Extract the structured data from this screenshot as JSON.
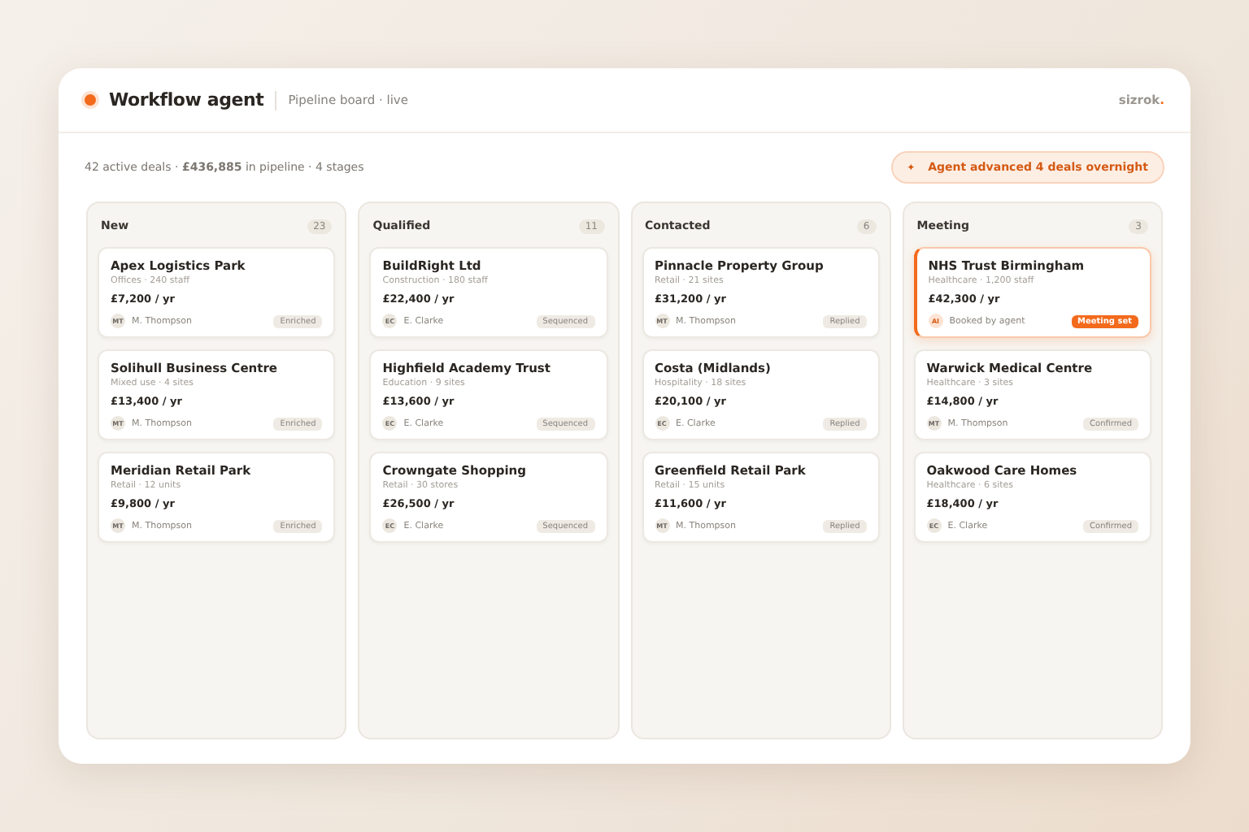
{
  "header": {
    "title": "Workflow agent",
    "subtitle": "Pipeline board · live",
    "brand": "sizrok",
    "brand_mark": "."
  },
  "summary": {
    "text": "42 active deals · **£436,885** in pipeline · 4 stages",
    "alert_icon": "✦",
    "alert": "Agent advanced 4 deals overnight"
  },
  "columns": [
    {
      "name": "New",
      "count": "23",
      "cards": [
        {
          "title": "Apex Logistics Park",
          "meta": "Offices · 240 staff",
          "value": "£7,200 / yr",
          "initials": "MT",
          "owner": "M. Thompson",
          "tag": "Enriched",
          "highlighted": false
        },
        {
          "title": "Solihull Business Centre",
          "meta": "Mixed use · 4 sites",
          "value": "£13,400 / yr",
          "initials": "MT",
          "owner": "M. Thompson",
          "tag": "Enriched",
          "highlighted": false
        },
        {
          "title": "Meridian Retail Park",
          "meta": "Retail · 12 units",
          "value": "£9,800 / yr",
          "initials": "MT",
          "owner": "M. Thompson",
          "tag": "Enriched",
          "highlighted": false
        }
      ]
    },
    {
      "name": "Qualified",
      "count": "11",
      "cards": [
        {
          "title": "BuildRight Ltd",
          "meta": "Construction · 180 staff",
          "value": "£22,400 / yr",
          "initials": "EC",
          "owner": "E. Clarke",
          "tag": "Sequenced",
          "highlighted": false
        },
        {
          "title": "Highfield Academy Trust",
          "meta": "Education · 9 sites",
          "value": "£13,600 / yr",
          "initials": "EC",
          "owner": "E. Clarke",
          "tag": "Sequenced",
          "highlighted": false
        },
        {
          "title": "Crowngate Shopping",
          "meta": "Retail · 30 stores",
          "value": "£26,500 / yr",
          "initials": "EC",
          "owner": "E. Clarke",
          "tag": "Sequenced",
          "highlighted": false
        }
      ]
    },
    {
      "name": "Contacted",
      "count": "6",
      "cards": [
        {
          "title": "Pinnacle Property Group",
          "meta": "Retail · 21 sites",
          "value": "£31,200 / yr",
          "initials": "MT",
          "owner": "M. Thompson",
          "tag": "Replied",
          "highlighted": false
        },
        {
          "title": "Costa (Midlands)",
          "meta": "Hospitality · 18 sites",
          "value": "£20,100 / yr",
          "initials": "EC",
          "owner": "E. Clarke",
          "tag": "Replied",
          "highlighted": false
        },
        {
          "title": "Greenfield Retail Park",
          "meta": "Retail · 15 units",
          "value": "£11,600 / yr",
          "initials": "MT",
          "owner": "M. Thompson",
          "tag": "Replied",
          "highlighted": false
        }
      ]
    },
    {
      "name": "Meeting",
      "count": "3",
      "cards": [
        {
          "title": "NHS Trust Birmingham",
          "meta": "Healthcare · 1,200 staff",
          "value": "£42,300 / yr",
          "initials": "AI",
          "owner": "Booked by agent",
          "tag": "Meeting set",
          "highlighted": true
        },
        {
          "title": "Warwick Medical Centre",
          "meta": "Healthcare · 3 sites",
          "value": "£14,800 / yr",
          "initials": "MT",
          "owner": "M. Thompson",
          "tag": "Confirmed",
          "highlighted": false
        },
        {
          "title": "Oakwood Care Homes",
          "meta": "Healthcare · 6 sites",
          "value": "£18,400 / yr",
          "initials": "EC",
          "owner": "E. Clarke",
          "tag": "Confirmed",
          "highlighted": false
        }
      ]
    }
  ]
}
